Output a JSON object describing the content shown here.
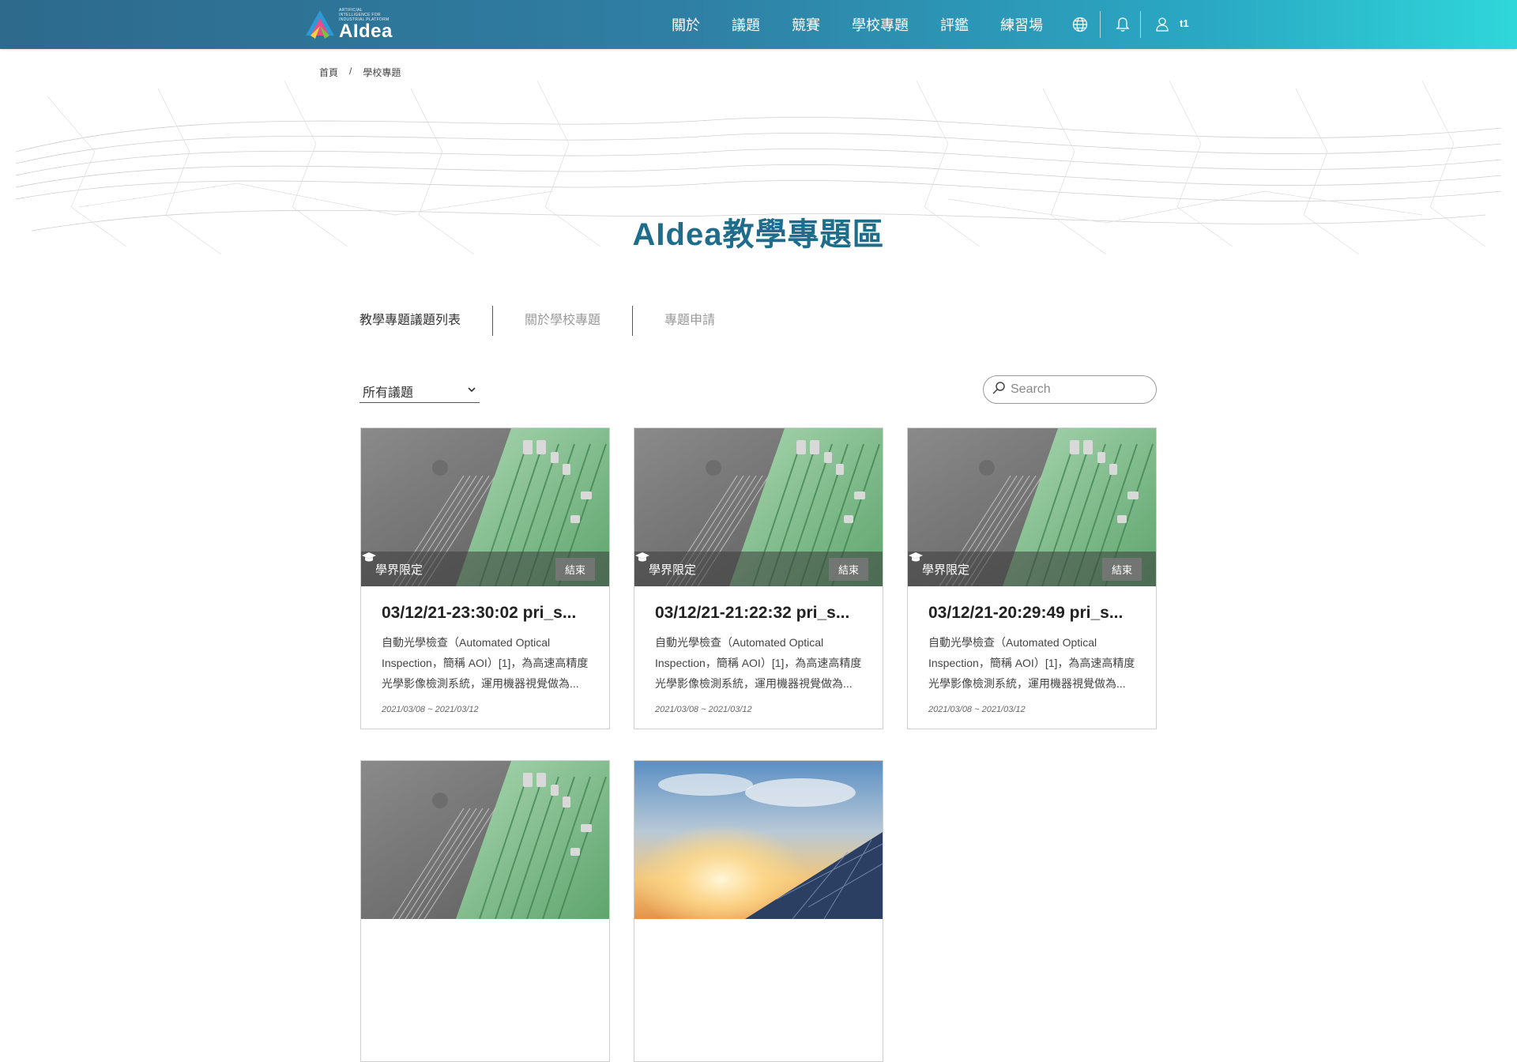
{
  "header": {
    "logo_text": "AIdea",
    "logo_tagline": "ARTIFICIAL INTELLIGENCE FOR INDUSTRIAL PLATFORM",
    "nav": [
      "關於",
      "議題",
      "競賽",
      "學校專題",
      "評鑑",
      "練習場"
    ],
    "icons": [
      "globe-icon",
      "bell-icon",
      "user-icon"
    ],
    "user_name": "t1"
  },
  "breadcrumb": {
    "home": "首頁",
    "separator": "/",
    "current": "學校專題"
  },
  "hero": {
    "title": "AIdea教學專題區"
  },
  "tabs": [
    "教學專題議題列表",
    "關於學校專題",
    "專題申請"
  ],
  "filter": {
    "selected": "所有議題"
  },
  "search": {
    "placeholder": "Search"
  },
  "cards": [
    {
      "badge": "學界限定",
      "status": "結束",
      "title": "03/12/21-23:30:02 pri_s...",
      "desc": "自動光學檢查（Automated Optical Inspection，簡稱 AOI）[1]，為高速高精度光學影像檢測系統，運用機器視覺做為...",
      "date": "2021/03/08 ~ 2021/03/12",
      "image": "circuit-board"
    },
    {
      "badge": "學界限定",
      "status": "結束",
      "title": "03/12/21-21:22:32 pri_s...",
      "desc": "自動光學檢查（Automated Optical Inspection，簡稱 AOI）[1]，為高速高精度光學影像檢測系統，運用機器視覺做為...",
      "date": "2021/03/08 ~ 2021/03/12",
      "image": "circuit-board"
    },
    {
      "badge": "學界限定",
      "status": "結束",
      "title": "03/12/21-20:29:49 pri_s...",
      "desc": "自動光學檢查（Automated Optical Inspection，簡稱 AOI）[1]，為高速高精度光學影像檢測系統，運用機器視覺做為...",
      "date": "2021/03/08 ~ 2021/03/12",
      "image": "circuit-board"
    },
    {
      "image": "circuit-board"
    },
    {
      "image": "solar-sunset"
    }
  ],
  "colors": {
    "header_start": "#2d6a8c",
    "header_end": "#2fd7da",
    "title": "#1f6d8a"
  }
}
